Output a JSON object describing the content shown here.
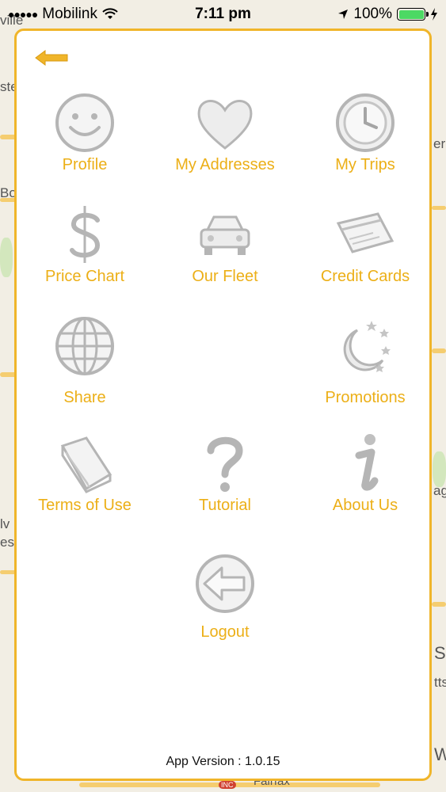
{
  "status_bar": {
    "signal": "●●●●●",
    "carrier": "Mobilink",
    "time": "7:11 pm",
    "battery": "100%"
  },
  "colors": {
    "accent": "#ecaf17",
    "panel_border": "#f0b52a",
    "icon_gray": "#bdbdbd"
  },
  "menu": {
    "items": [
      {
        "label": "Profile",
        "icon": "smiley-icon"
      },
      {
        "label": "My Addresses",
        "icon": "heart-icon"
      },
      {
        "label": "My Trips",
        "icon": "clock-icon"
      },
      {
        "label": "Price Chart",
        "icon": "dollar-icon"
      },
      {
        "label": "Our Fleet",
        "icon": "car-icon"
      },
      {
        "label": "Credit Cards",
        "icon": "credit-card-icon"
      },
      {
        "label": "Share",
        "icon": "globe-icon"
      },
      {
        "label": "Promotions",
        "icon": "moon-stars-icon"
      },
      {
        "label": "Terms of Use",
        "icon": "book-icon"
      },
      {
        "label": "Tutorial",
        "icon": "question-icon"
      },
      {
        "label": "About Us",
        "icon": "info-icon"
      },
      {
        "label": "Logout",
        "icon": "back-arrow-circle-icon"
      }
    ]
  },
  "footer": {
    "version": "App Version : 1.0.15"
  },
  "map_labels": [
    "ville",
    "ste",
    "Bo",
    "er",
    "ag",
    "lv",
    "es",
    "S",
    "tts",
    "W",
    "Fairfax",
    "INC"
  ]
}
